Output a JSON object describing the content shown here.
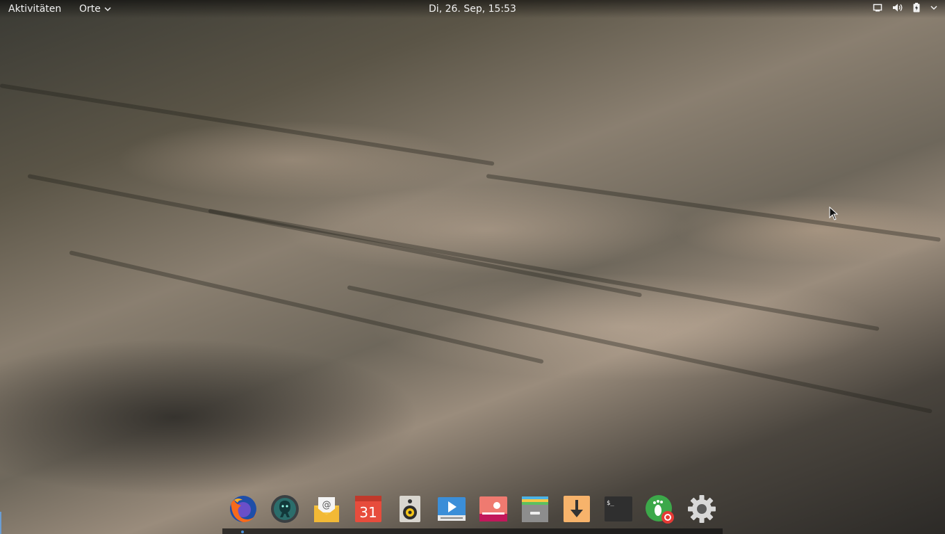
{
  "topbar": {
    "activities_label": "Aktivitäten",
    "places_label": "Orte",
    "clock": "Di, 26. Sep, 15:53",
    "status_icons": [
      "screen-icon",
      "volume-icon",
      "battery-icon",
      "system-menu-chevron-icon"
    ]
  },
  "dock": {
    "items": [
      {
        "name": "firefox",
        "icon": "firefox-icon"
      },
      {
        "name": "gitkraken",
        "icon": "gitkraken-icon"
      },
      {
        "name": "mail",
        "icon": "mail-icon"
      },
      {
        "name": "calendar",
        "icon": "calendar-icon",
        "text": "31"
      },
      {
        "name": "rhythmbox",
        "icon": "speaker-icon"
      },
      {
        "name": "videos",
        "icon": "video-player-icon"
      },
      {
        "name": "photos",
        "icon": "photos-icon"
      },
      {
        "name": "archive-manager",
        "icon": "archive-icon"
      },
      {
        "name": "transmission",
        "icon": "download-icon"
      },
      {
        "name": "terminal",
        "icon": "terminal-icon",
        "text": "$_"
      },
      {
        "name": "software-updater",
        "icon": "software-icon"
      },
      {
        "name": "settings",
        "icon": "gear-icon"
      }
    ]
  },
  "colors": {
    "dock_indicator": "#4a90d9",
    "calendar_red": "#e74c3c",
    "mail_yellow": "#f6c544",
    "video_blue": "#3b8ed8",
    "photo_pink": "#e9595e",
    "download_orange": "#f7b36b",
    "software_green": "#3ca84a",
    "gear_gray": "#d8d8d8"
  }
}
